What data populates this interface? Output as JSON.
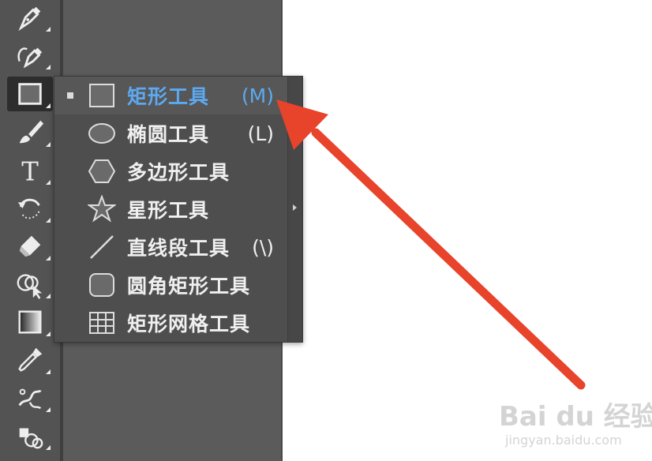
{
  "toolbar": {
    "tools": [
      {
        "name": "pen-tool",
        "icon": "pen-icon"
      },
      {
        "name": "curvature-tool",
        "icon": "curvature-pen-icon"
      },
      {
        "name": "rectangle-tool",
        "icon": "rectangle-icon",
        "active": true
      },
      {
        "name": "paintbrush-tool",
        "icon": "brush-icon"
      },
      {
        "name": "type-tool",
        "icon": "type-icon",
        "text": "T"
      },
      {
        "name": "rotate-tool",
        "icon": "rotate-icon"
      },
      {
        "name": "eraser-tool",
        "icon": "eraser-icon"
      },
      {
        "name": "shape-builder-tool",
        "icon": "shape-builder-icon"
      },
      {
        "name": "gradient-tool",
        "icon": "gradient-icon"
      },
      {
        "name": "eyedropper-tool",
        "icon": "eyedropper-icon"
      },
      {
        "name": "puppet-warp-tool",
        "icon": "puppet-warp-icon"
      },
      {
        "name": "symbol-sprayer-tool",
        "icon": "symbol-sprayer-icon"
      }
    ]
  },
  "flyout": {
    "items": [
      {
        "label": "矩形工具",
        "shortcut": "(M)",
        "icon": "rectangle-icon",
        "selected": true
      },
      {
        "label": "椭圆工具",
        "shortcut": "(L)",
        "icon": "ellipse-icon"
      },
      {
        "label": "多边形工具",
        "shortcut": "",
        "icon": "polygon-icon"
      },
      {
        "label": "星形工具",
        "shortcut": "",
        "icon": "star-icon"
      },
      {
        "label": "直线段工具",
        "shortcut": "(\\)",
        "icon": "line-icon"
      },
      {
        "label": "圆角矩形工具",
        "shortcut": "",
        "icon": "rounded-rectangle-icon"
      },
      {
        "label": "矩形网格工具",
        "shortcut": "",
        "icon": "grid-icon"
      }
    ]
  },
  "annotation": {
    "color": "#e8432b"
  },
  "watermark": {
    "main": "Bai du 经验",
    "sub": "jingyan.baidu.com"
  },
  "colors": {
    "selected_text": "#5da9f0",
    "toolbar": "#535353",
    "panel": "#5b5b5b"
  }
}
